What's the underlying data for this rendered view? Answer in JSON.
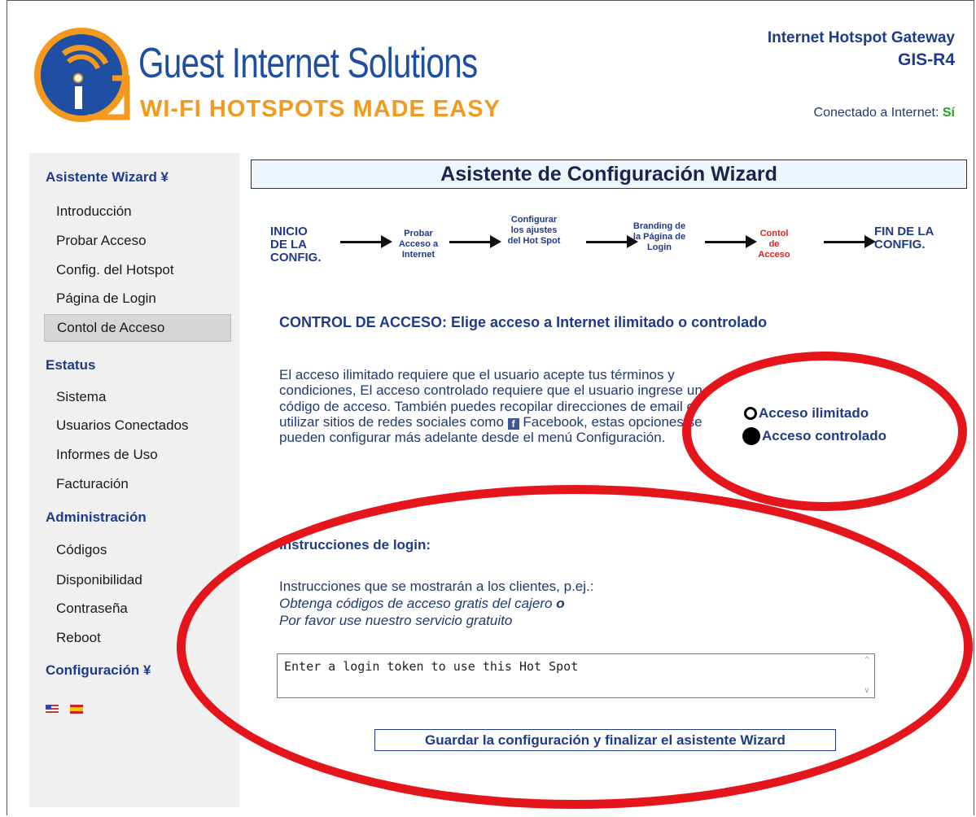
{
  "header": {
    "brand_title": "Guest Internet Solutions",
    "brand_tagline": "WI-FI HOTSPOTS MADE EASY",
    "product_line1": "Internet Hotspot Gateway",
    "product_line2": "GIS-R4",
    "connection_label": "Conectado a Internet:",
    "connection_status": "Sí"
  },
  "sidebar": {
    "wizard_head": "Asistente Wizard ¥",
    "wizard_items": [
      "Introducción",
      "Probar Acceso",
      "Config. del Hotspot",
      "Página de Login",
      "Contol de Acceso"
    ],
    "status_head": "Estatus",
    "status_items": [
      "Sistema",
      "Usuarios Conectados",
      "Informes de Uso",
      "Facturación"
    ],
    "admin_head": "Administración",
    "admin_items": [
      "Códigos",
      "Disponibilidad",
      "Contraseña",
      "Reboot"
    ],
    "config_head": "Configuración ¥"
  },
  "main": {
    "title": "Asistente de Configuración Wizard",
    "steps": {
      "start": "INICIO DE LA CONFIG.",
      "test": "Probar Acceso a Internet",
      "configure": "Configurar los ajustes del Hot Spot",
      "branding": "Branding de la Página de Login",
      "control": "Contol de Acceso",
      "end": "FIN DE LA CONFIG."
    },
    "section_title": "CONTROL DE ACCESO: Elige acceso a Internet ilimitado o controlado",
    "description_before_fb": "El acceso ilimitado requiere que el usuario acepte tus términos y condiciones, El acceso controlado requiere que el usuario ingrese un código de acceso. También puedes recopilar direcciones de email o utilizar sitios de redes sociales como ",
    "facebook_label": "Facebook",
    "description_after_fb": ", estas opciones se pueden configurar más adelante desde el menú Configuración.",
    "radio_unlimited": "Acceso ilimitado",
    "radio_controlled": "Acceso controlado",
    "selected_option": "Acceso controlado",
    "instructions_title": "Instrucciones de login:",
    "instructions_text": "Instrucciones que se mostrarán a los clientes, p.ej.:",
    "example1": "Obtenga códigos de acceso gratis del cajero",
    "example_join": "o",
    "example2": "Por favor use nuestro servicio gratuito",
    "login_instructions_value": "Enter a login token to use this Hot Spot",
    "save_button": "Guardar la configuración y finalizar el asistente Wizard"
  },
  "colors": {
    "accent_blue": "#1f3a8a",
    "annotation_red": "#e4161c",
    "current_step": "#e02020",
    "connected_green": "#1ea51e"
  }
}
